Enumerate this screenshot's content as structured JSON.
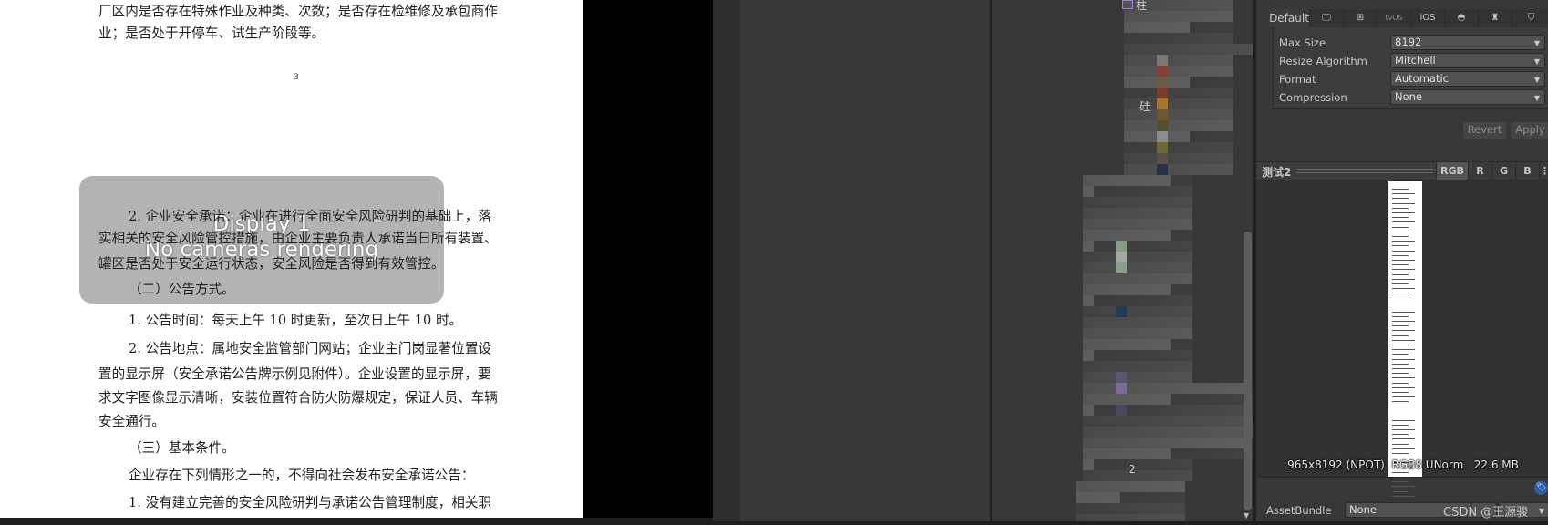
{
  "document": {
    "lines": [
      "厂区内是否存在特殊作业及种类、次数；是否存在检维修及承包商作",
      "业；是否处于开停车、试生产阶段等。",
      "2. 企业安全承诺：企业在进行全面安全风险研判的基础上，落",
      "实相关的安全风险管控措施，由企业主要负责人承诺当日所有装置、",
      "罐区是否处于安全运行状态，安全风险是否得到有效管控。",
      "（二）公告方式。",
      "1. 公告时间：每天上午 10 时更新，至次日上午 10 时。",
      "2. 公告地点：属地安全监管部门网站；企业主门岗显著位置设",
      "置的显示屏（安全承诺公告牌示例见附件）。企业设置的显示屏，要",
      "求文字图像显示清晰，安装位置符合防火防爆规定，保证人员、车辆",
      "安全通行。",
      "（三）基本条件。",
      "企业存在下列情形之一的，不得向社会发布安全承诺公告：",
      "1. 没有建立完善的安全风险研判与承诺公告管理制度，相关职"
    ],
    "page_number": "3"
  },
  "game_view": {
    "display": "Display 1",
    "message": "No cameras rendering"
  },
  "hierarchy": {
    "fragments": [
      "柱",
      "硅",
      "2"
    ]
  },
  "inspector": {
    "platform_tabs": [
      {
        "label": "Default",
        "icon": ""
      },
      {
        "label": "",
        "icon": "monitor-icon"
      },
      {
        "label": "",
        "icon": "windows-icon"
      },
      {
        "label": "tvOS",
        "icon": ""
      },
      {
        "label": "iOS",
        "icon": ""
      },
      {
        "label": "",
        "icon": "webgl-icon"
      },
      {
        "label": "",
        "icon": "android-icon"
      },
      {
        "label": "",
        "icon": "html5-icon"
      }
    ],
    "fields": [
      {
        "label": "Max Size",
        "value": "8192"
      },
      {
        "label": "Resize Algorithm",
        "value": "Mitchell"
      },
      {
        "label": "Format",
        "value": "Automatic"
      },
      {
        "label": "Compression",
        "value": "None"
      }
    ],
    "revert": "Revert",
    "apply": "Apply",
    "preview": {
      "title": "测试2",
      "channels": [
        "RGB",
        "R",
        "G",
        "B"
      ],
      "info": "965x8192 (NPOT)  RGB8 UNorm   22.6 MB"
    },
    "asset_bundle": {
      "label": "AssetBundle",
      "value": "None"
    },
    "watermark": "CSDN @王源骏"
  }
}
